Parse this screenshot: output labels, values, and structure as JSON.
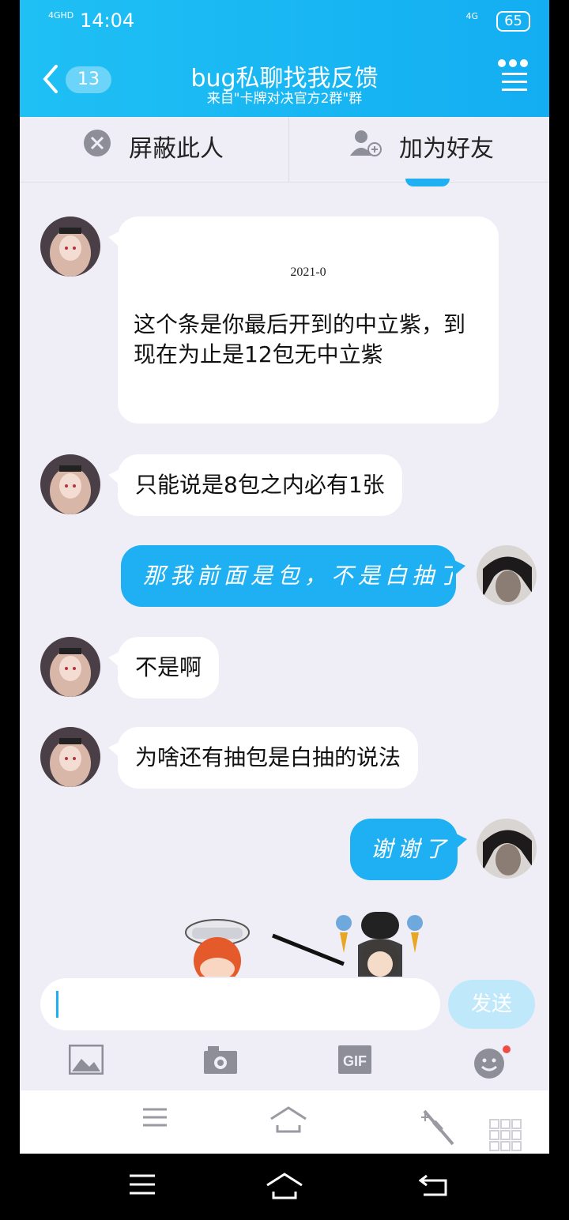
{
  "status": {
    "network": "4GHD",
    "time": "14:04",
    "network2": "4G",
    "battery": "65"
  },
  "header": {
    "back_count": "13",
    "title": "bug私聊找我反馈",
    "subtitle": "来自\"卡牌对决官方2群\"群",
    "menu_icon": "more-icon"
  },
  "actions": {
    "block_label": "屏蔽此人",
    "add_label": "加为好友"
  },
  "messages": [
    {
      "side": "in",
      "image_text": "2021-0",
      "text": "这个条是你最后开到的中立紫，到现在为止是12包无中立紫"
    },
    {
      "side": "in",
      "text": "只能说是8包之内必有1张"
    },
    {
      "side": "out",
      "text": "那我前面是包，不是白抽了"
    },
    {
      "side": "in",
      "text": "不是啊"
    },
    {
      "side": "in",
      "text": "为啥还有抽包是白抽的说法"
    },
    {
      "side": "out",
      "text": "谢谢了"
    }
  ],
  "input": {
    "placeholder": "",
    "send_label": "发送"
  },
  "toolbar": {
    "items": [
      "image-icon",
      "camera-icon",
      "gif-icon",
      "emoji-icon"
    ],
    "gif_label": "GIF"
  },
  "colors": {
    "header": "#13aef2",
    "bubble_out": "#1fb0f3",
    "send_disabled": "#bfe9fb",
    "background": "#efeef6"
  }
}
